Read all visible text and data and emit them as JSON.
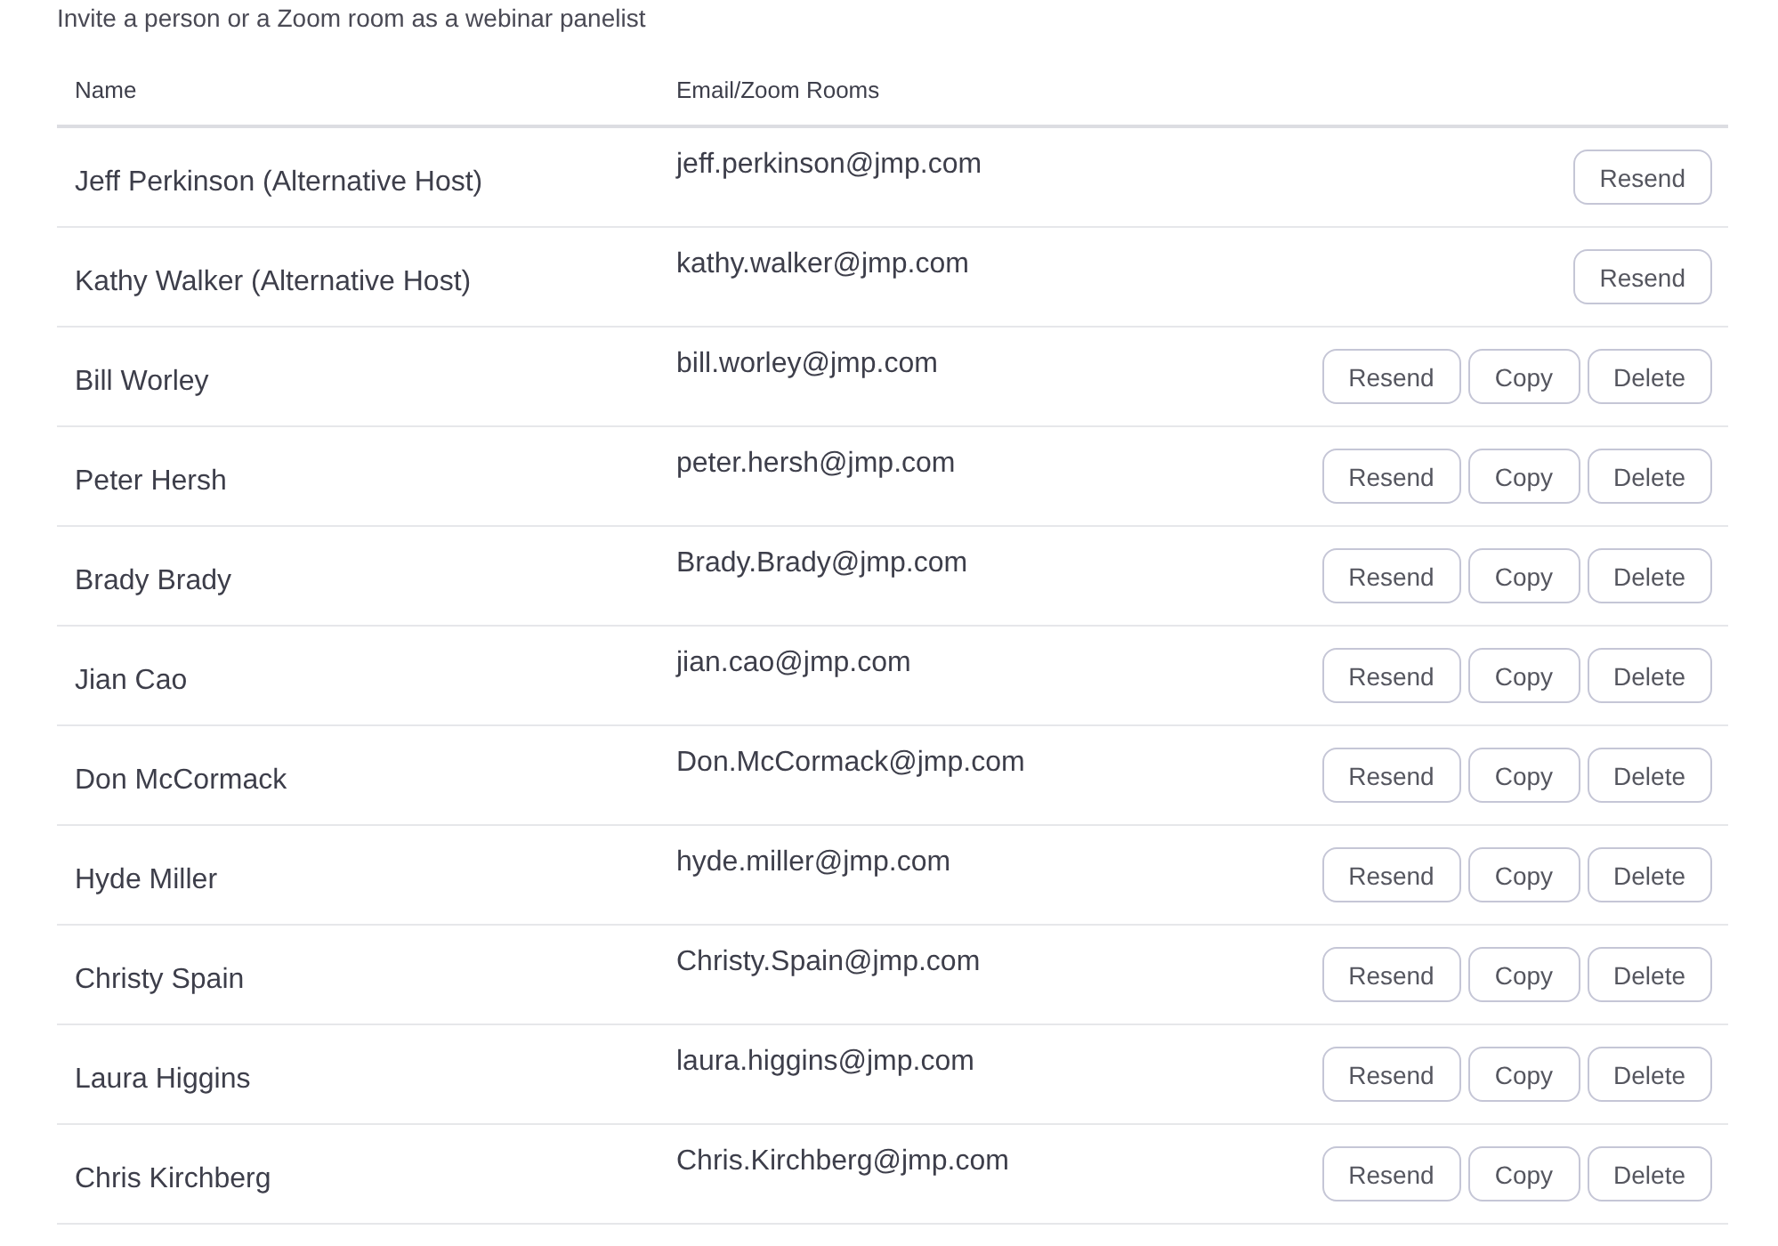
{
  "caption": "Invite a person or a Zoom room as a webinar panelist",
  "table": {
    "columns": [
      "Name",
      "Email/Zoom Rooms"
    ],
    "rows": [
      {
        "name": "Jeff Perkinson (Alternative Host)",
        "email": "jeff.perkinson@jmp.com",
        "buttons": [
          "Resend"
        ]
      },
      {
        "name": "Kathy Walker (Alternative Host)",
        "email": "kathy.walker@jmp.com",
        "buttons": [
          "Resend"
        ]
      },
      {
        "name": "Bill Worley",
        "email": "bill.worley@jmp.com",
        "buttons": [
          "Resend",
          "Copy",
          "Delete"
        ]
      },
      {
        "name": "Peter Hersh",
        "email": "peter.hersh@jmp.com",
        "buttons": [
          "Resend",
          "Copy",
          "Delete"
        ]
      },
      {
        "name": "Brady Brady",
        "email": "Brady.Brady@jmp.com",
        "buttons": [
          "Resend",
          "Copy",
          "Delete"
        ]
      },
      {
        "name": "Jian Cao",
        "email": "jian.cao@jmp.com",
        "buttons": [
          "Resend",
          "Copy",
          "Delete"
        ]
      },
      {
        "name": "Don McCormack",
        "email": "Don.McCormack@jmp.com",
        "buttons": [
          "Resend",
          "Copy",
          "Delete"
        ]
      },
      {
        "name": "Hyde Miller",
        "email": "hyde.miller@jmp.com",
        "buttons": [
          "Resend",
          "Copy",
          "Delete"
        ]
      },
      {
        "name": "Christy Spain",
        "email": "Christy.Spain@jmp.com",
        "buttons": [
          "Resend",
          "Copy",
          "Delete"
        ]
      },
      {
        "name": "Laura Higgins",
        "email": "laura.higgins@jmp.com",
        "buttons": [
          "Resend",
          "Copy",
          "Delete"
        ]
      },
      {
        "name": "Chris Kirchberg",
        "email": "Chris.Kirchberg@jmp.com",
        "buttons": [
          "Resend",
          "Copy",
          "Delete"
        ]
      }
    ]
  }
}
